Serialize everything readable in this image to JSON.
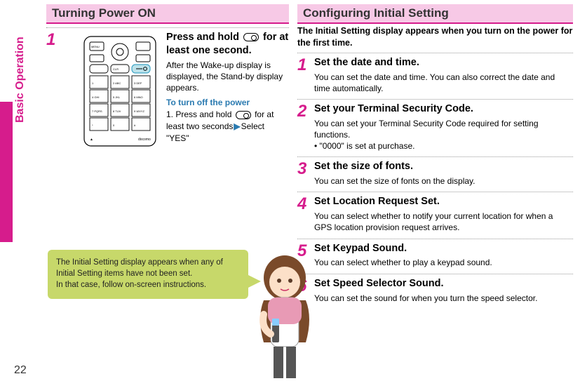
{
  "page_number": "22",
  "side_label": "Basic Operation",
  "left": {
    "header": "Turning Power ON",
    "step1": {
      "num": "1",
      "title_pre": "Press and hold ",
      "title_post": " for at least one second.",
      "desc": "After the Wake-up display is displayed, the Stand-by display appears.",
      "sub_title": "To turn off the power",
      "sub_pre": "1. Press and hold ",
      "sub_mid": " for at least two seconds",
      "sub_post": "Select \"YES\""
    },
    "callout_line1": "The Initial Setting display appears when any of Initial Setting items have not been set.",
    "callout_line2": "In that case, follow on-screen instructions."
  },
  "right": {
    "header": "Configuring Initial Setting",
    "intro": "The Initial Setting display appears when you turn on the power for the first time.",
    "steps": [
      {
        "num": "1",
        "title": "Set the date and time.",
        "desc": "You can set the date and time. You can also correct the date and time automatically."
      },
      {
        "num": "2",
        "title": "Set your Terminal Security Code.",
        "desc": "You can set your Terminal Security Code required for setting functions.",
        "bullet": "• \"0000\" is set at purchase."
      },
      {
        "num": "3",
        "title": "Set the size of fonts.",
        "desc": "You can set the size of fonts on the display."
      },
      {
        "num": "4",
        "title": "Set Location Request Set.",
        "desc": "You can select whether to notify your current location for when a GPS location provision request arrives."
      },
      {
        "num": "5",
        "title": "Set Keypad Sound.",
        "desc": "You can select whether to play a keypad sound."
      },
      {
        "num": "6",
        "title": "Set Speed Selector Sound.",
        "desc": "You can set the sound for when you turn the speed selector."
      }
    ]
  }
}
